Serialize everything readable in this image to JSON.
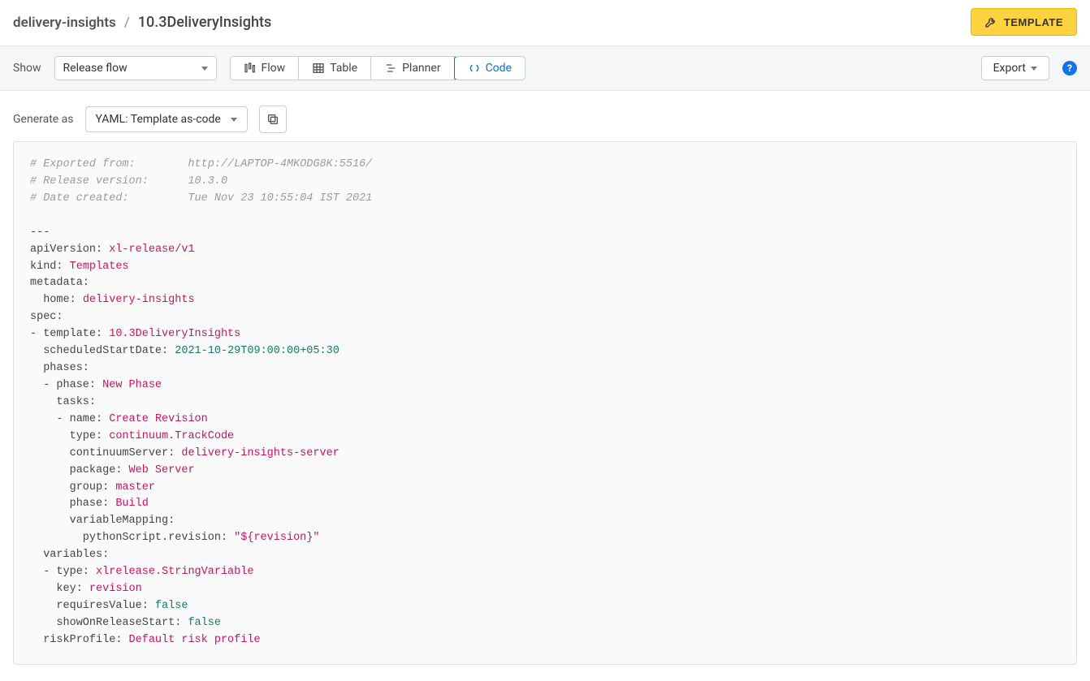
{
  "breadcrumb": {
    "folder": "delivery-insights",
    "separator": "/",
    "name": "10.3DeliveryInsights"
  },
  "template_button": "TEMPLATE",
  "toolbar": {
    "show_label": "Show",
    "show_value": "Release flow",
    "tabs": {
      "flow": "Flow",
      "table": "Table",
      "planner": "Planner",
      "code": "Code"
    },
    "export_label": "Export",
    "help_glyph": "?"
  },
  "generate": {
    "label": "Generate as",
    "value": "YAML: Template as-code"
  },
  "code": {
    "c1": "# Exported from:        http://LAPTOP-4MKODG8K:5516/",
    "c2": "# Release version:      10.3.0",
    "c3": "# Date created:         Tue Nov 23 10:55:04 IST 2021",
    "dash3": "---",
    "apiVersion_k": "apiVersion:",
    "apiVersion_v": "xl-release/v1",
    "kind_k": "kind:",
    "kind_v": "Templates",
    "metadata_k": "metadata:",
    "home_k": "  home:",
    "home_v": "delivery-insights",
    "spec_k": "spec:",
    "template_k": "- template:",
    "template_v": "10.3DeliveryInsights",
    "ssd_k": "  scheduledStartDate:",
    "ssd_v1": "2021-10",
    "ssd_dash": "-",
    "ssd_v2": "29T09:00:00+05:30",
    "phases_k": "  phases:",
    "phase_k": "  - phase:",
    "phase_v": "New Phase",
    "tasks_k": "    tasks:",
    "name_k": "    - name:",
    "name_v": "Create Revision",
    "type_k": "      type:",
    "type_v": "continuum.TrackCode",
    "cs_k": "      continuumServer:",
    "cs_v": "delivery-insights-server",
    "pkg_k": "      package:",
    "pkg_v": "Web Server",
    "group_k": "      group:",
    "group_v": "master",
    "phase2_k": "      phase:",
    "phase2_v": "Build",
    "vm_k": "      variableMapping:",
    "psr_k": "        pythonScript.revision:",
    "psr_v": "\"${revision}\"",
    "vars_k": "  variables:",
    "vtype_k": "  - type:",
    "vtype_v": "xlrelease.StringVariable",
    "vkey_k": "    key:",
    "vkey_v": "revision",
    "req_k": "    requiresValue:",
    "req_v": "false",
    "sor_k": "    showOnReleaseStart:",
    "sor_v": "false",
    "risk_k": "  riskProfile:",
    "risk_v": "Default risk profile"
  }
}
